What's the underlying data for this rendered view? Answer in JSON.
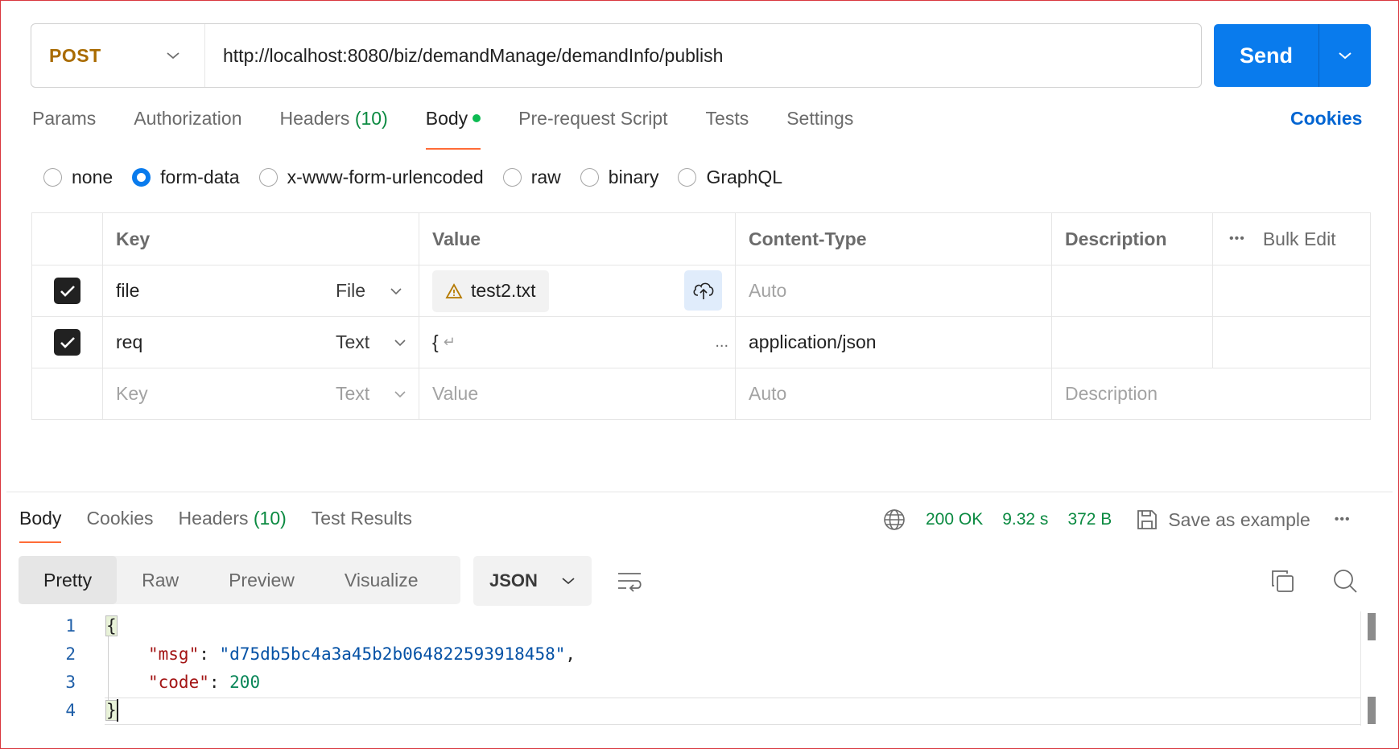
{
  "request": {
    "method": "POST",
    "url": "http://localhost:8080/biz/demandManage/demandInfo/publish",
    "send_label": "Send"
  },
  "req_tabs": [
    {
      "label": "Params"
    },
    {
      "label": "Authorization"
    },
    {
      "label": "Headers",
      "count": "(10)"
    },
    {
      "label": "Body"
    },
    {
      "label": "Pre-request Script"
    },
    {
      "label": "Tests"
    },
    {
      "label": "Settings"
    }
  ],
  "cookies_link": "Cookies",
  "body_types": [
    {
      "label": "none",
      "checked": false
    },
    {
      "label": "form-data",
      "checked": true
    },
    {
      "label": "x-www-form-urlencoded",
      "checked": false
    },
    {
      "label": "raw",
      "checked": false
    },
    {
      "label": "binary",
      "checked": false
    },
    {
      "label": "GraphQL",
      "checked": false
    }
  ],
  "table": {
    "headers": {
      "key": "Key",
      "value": "Value",
      "content_type": "Content-Type",
      "description": "Description",
      "bulk_edit": "Bulk Edit",
      "more": "•••"
    },
    "rows": [
      {
        "key": "file",
        "type": "File",
        "value": "test2.txt",
        "content_type": "Auto"
      },
      {
        "key": "req",
        "type": "Text",
        "value": "{",
        "ellipsis": "...",
        "content_type": "application/json"
      }
    ],
    "placeholder": {
      "key": "Key",
      "type": "Text",
      "value": "Value",
      "content_type": "Auto",
      "description": "Description"
    }
  },
  "response": {
    "tabs": [
      {
        "label": "Body"
      },
      {
        "label": "Cookies"
      },
      {
        "label": "Headers",
        "count": "(10)"
      },
      {
        "label": "Test Results"
      }
    ],
    "status": "200 OK",
    "time": "9.32 s",
    "size": "372 B",
    "save_label": "Save as example",
    "more": "•••",
    "views": [
      "Pretty",
      "Raw",
      "Preview",
      "Visualize"
    ],
    "language": "JSON",
    "code": {
      "line_numbers": [
        "1",
        "2",
        "3",
        "4"
      ],
      "open_brace": "{",
      "close_brace": "}",
      "msg_key": "\"msg\"",
      "msg_value": "\"d75db5bc4a3a45b2b064822593918458\"",
      "code_key": "\"code\"",
      "code_value": "200",
      "colon": ": ",
      "comma": ","
    }
  },
  "colors": {
    "accent": "#097bed",
    "method": "#a96b00",
    "success": "#0b8a41",
    "active_tab": "#ff6c37"
  }
}
